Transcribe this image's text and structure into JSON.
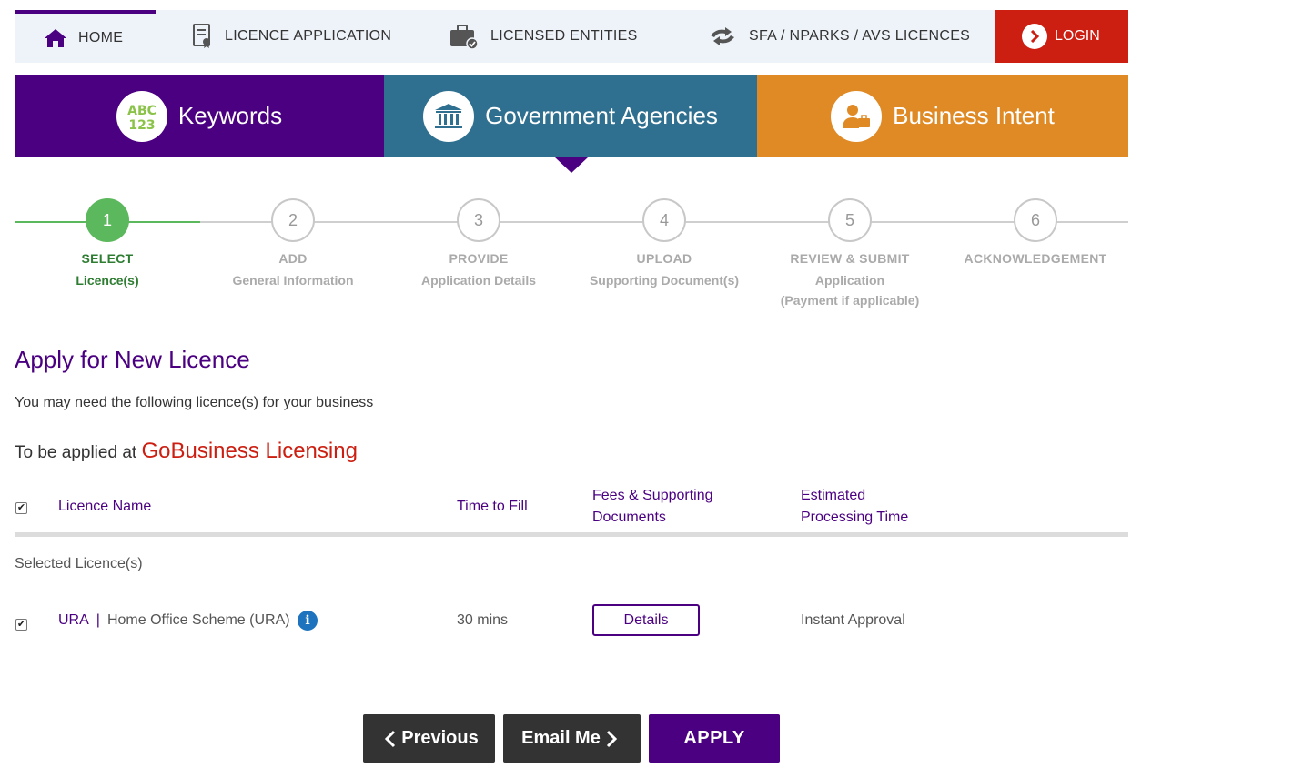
{
  "nav": {
    "home": "HOME",
    "licence_application": "LICENCE APPLICATION",
    "licensed_entities": "LICENSED ENTITIES",
    "sfa": "SFA / NPARKS / AVS LICENCES",
    "login": "LOGIN"
  },
  "tabs": {
    "keywords": "Keywords",
    "keywords_icon_text": "ABC 123",
    "government": "Government Agencies",
    "business": "Business Intent"
  },
  "steps": [
    {
      "num": "1",
      "t1": "SELECT",
      "t2": "Licence(s)",
      "t3": ""
    },
    {
      "num": "2",
      "t1": "ADD",
      "t2": "General Information",
      "t3": ""
    },
    {
      "num": "3",
      "t1": "PROVIDE",
      "t2": "Application Details",
      "t3": ""
    },
    {
      "num": "4",
      "t1": "UPLOAD",
      "t2": "Supporting Document(s)",
      "t3": ""
    },
    {
      "num": "5",
      "t1": "REVIEW & SUBMIT",
      "t2": "Application",
      "t3": "(Payment if applicable)"
    },
    {
      "num": "6",
      "t1": "ACKNOWLEDGEMENT",
      "t2": "",
      "t3": ""
    }
  ],
  "content": {
    "title": "Apply for New Licence",
    "subtitle": "You may need the following licence(s) for your business",
    "applied_at_prefix": "To be applied at",
    "applied_at_brand": "GoBusiness Licensing"
  },
  "table": {
    "headers": {
      "name": "Licence Name",
      "time": "Time to Fill",
      "fees_line1": "Fees & Supporting",
      "fees_line2": "Documents",
      "est_line1": "Estimated",
      "est_line2": "Processing Time"
    },
    "selected_label": "Selected Licence(s)",
    "rows": [
      {
        "agency": "URA",
        "separator": "|",
        "name": "Home Office Scheme (URA)",
        "info": "i",
        "time": "30 mins",
        "details": "Details",
        "processing": "Instant Approval"
      }
    ]
  },
  "buttons": {
    "previous": "Previous",
    "email": "Email Me",
    "apply": "APPLY"
  },
  "colors": {
    "purple": "#4b0082",
    "teal": "#2f6f8f",
    "orange": "#e08a26",
    "red": "#cc1f11",
    "green": "#5cb85c"
  }
}
